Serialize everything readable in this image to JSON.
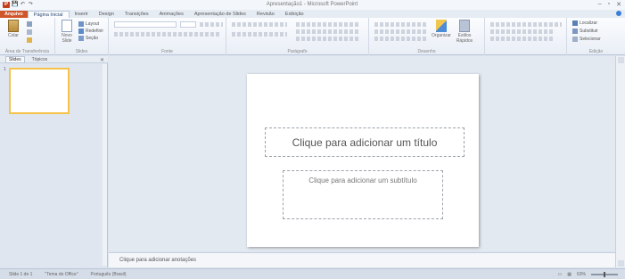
{
  "window": {
    "title": "Apresentação1 - Microsoft PowerPoint",
    "controls": [
      "–",
      "▫",
      "✕"
    ]
  },
  "quick_access": [
    "P",
    "💾",
    "↶",
    "↷"
  ],
  "tabs": [
    {
      "label": "Arquivo",
      "kind": "file"
    },
    {
      "label": "Página Inicial",
      "kind": "active"
    },
    {
      "label": "Inserir",
      "kind": ""
    },
    {
      "label": "Design",
      "kind": ""
    },
    {
      "label": "Transições",
      "kind": ""
    },
    {
      "label": "Animações",
      "kind": ""
    },
    {
      "label": "Apresentação de Slides",
      "kind": ""
    },
    {
      "label": "Revisão",
      "kind": ""
    },
    {
      "label": "Exibição",
      "kind": ""
    }
  ],
  "ribbon": {
    "clipboard": {
      "label": "Área de Transferência",
      "paste": "Colar"
    },
    "slides": {
      "label": "Slides",
      "new_slide": "Novo Slide",
      "layout": "Layout",
      "reset": "Redefinir",
      "section": "Seção"
    },
    "font": {
      "label": "Fonte"
    },
    "paragraph": {
      "label": "Parágrafo"
    },
    "drawing": {
      "label": "Desenho",
      "shapes": "Formas",
      "arrange": "Organizar",
      "quick_styles": "Estilos Rápidos"
    },
    "editing": {
      "label": "Edição",
      "find": "Localizar",
      "replace": "Substituir",
      "select": "Selecionar"
    }
  },
  "left_pane": {
    "tab_slides": "Slides",
    "tab_outline": "Tópicos",
    "slide_number": "1"
  },
  "slide": {
    "title_placeholder": "Clique para adicionar um título",
    "subtitle_placeholder": "Clique para adicionar um subtítulo"
  },
  "notes": {
    "placeholder": "Clique para adicionar anotações"
  },
  "status": {
    "slide_info": "Slide 1 de 1",
    "theme": "\"Tema do Office\"",
    "language": "Português (Brasil)",
    "zoom": "63%"
  },
  "colors": {
    "file_tab": "#d0562a",
    "selection": "#f7c24a"
  }
}
